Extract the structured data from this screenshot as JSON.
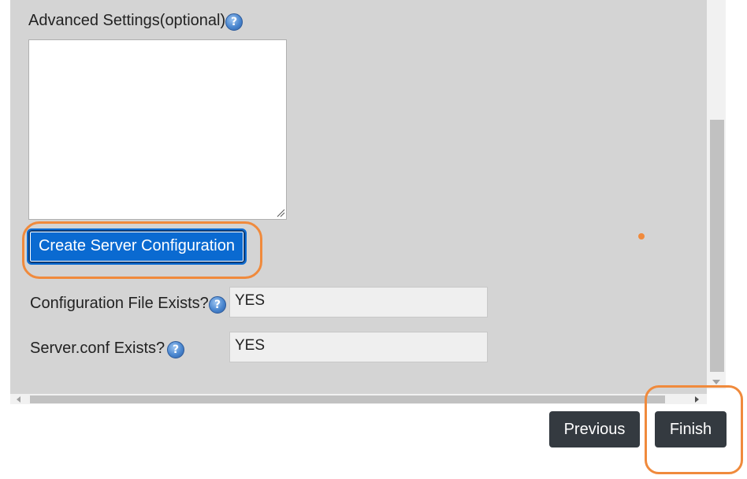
{
  "advanced_settings": {
    "label": "Advanced Settings(optional)",
    "help_glyph": "?",
    "textarea_value": ""
  },
  "create_button": {
    "label": "Create Server Configuration"
  },
  "fields": [
    {
      "label": "Configuration File Exists?",
      "value": "YES",
      "help_glyph": "?"
    },
    {
      "label": "Server.conf Exists?",
      "value": "YES",
      "help_glyph": "?"
    }
  ],
  "navigation": {
    "previous_label": "Previous",
    "finish_label": "Finish"
  },
  "colors": {
    "panel_bg": "#d4d4d4",
    "primary_button": "#0a6ad1",
    "nav_button": "#343a40",
    "annotation_highlight": "#f08a3c"
  }
}
